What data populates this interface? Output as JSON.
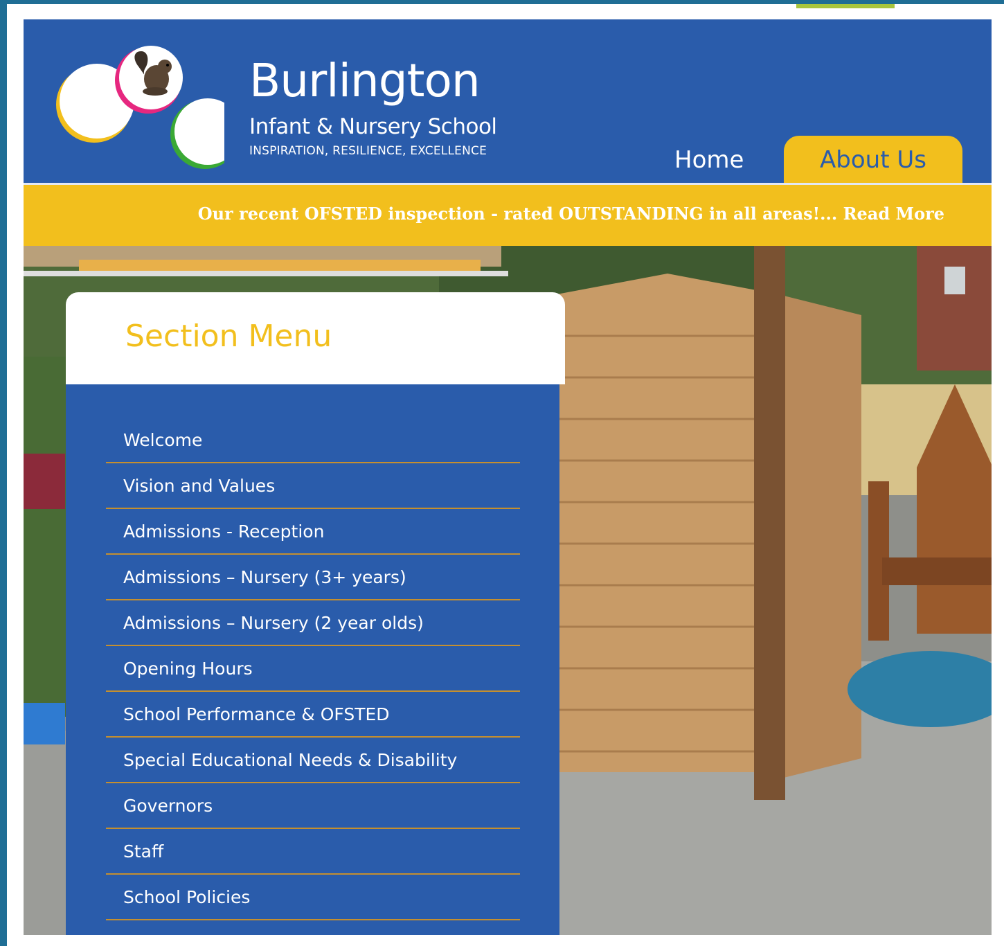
{
  "school": {
    "name": "Burlington",
    "subtitle": "Infant & Nursery School",
    "tagline": "INSPIRATION, RESILIENCE, EXCELLENCE"
  },
  "nav": {
    "home": "Home",
    "about": "About Us"
  },
  "banner": {
    "text": "Our recent OFSTED inspection - rated OUTSTANDING in all areas!... Read More"
  },
  "section_menu": {
    "title": "Section Menu",
    "items": [
      {
        "label": "Welcome"
      },
      {
        "label": "Vision and Values"
      },
      {
        "label": "Admissions - Reception"
      },
      {
        "label": "Admissions – Nursery (3+ years)"
      },
      {
        "label": "Admissions – Nursery (2 year olds)"
      },
      {
        "label": "Opening Hours"
      },
      {
        "label": "School Performance & OFSTED"
      },
      {
        "label": "Special Educational Needs & Disability"
      },
      {
        "label": "Governors"
      },
      {
        "label": "Staff"
      },
      {
        "label": "School Policies"
      }
    ]
  },
  "colors": {
    "primary_blue": "#2a5cab",
    "accent_yellow": "#f2bf1d",
    "divider": "#c58f2e"
  }
}
